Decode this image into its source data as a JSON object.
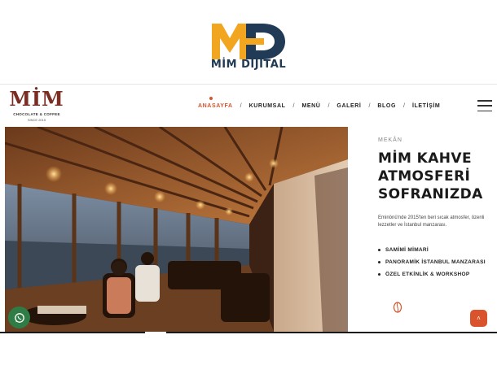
{
  "agency": {
    "name": "MİM DİJİTAL",
    "mark": "MD"
  },
  "brand": {
    "word": "MİM",
    "tagline": "CHOCOLATE & COFFEE",
    "since": "SINCE 2015"
  },
  "nav": {
    "items": [
      {
        "label": "ANASAYFA",
        "active": true
      },
      {
        "label": "KURUMSAL",
        "active": false
      },
      {
        "label": "MENÜ",
        "active": false
      },
      {
        "label": "GALERİ",
        "active": false
      },
      {
        "label": "BLOG",
        "active": false
      },
      {
        "label": "İLETİŞİM",
        "active": false
      }
    ],
    "separator": "/"
  },
  "hero": {
    "image": "restaurant-interior-wooden-ceiling-bosphorus-view"
  },
  "panel": {
    "eyebrow": "MEKÂN",
    "title": "MİM KAHVE ATMOSFERİ SOFRANIZDA",
    "description": "Eminönü'nde 2015'ten beri sıcak atmosfer, özenli lezzetler ve İstanbul manzarası.",
    "features": [
      "SAMİMİ MİMARİ",
      "PANORAMİK İSTANBUL MANZARASI",
      "ÖZEL ETKİNLİK & WORKSHOP"
    ],
    "icon": "coffee-bean-icon"
  },
  "colors": {
    "accent": "#d9532c",
    "brand": "#7a2d22",
    "agency_blue": "#213a55",
    "agency_orange": "#f2a51f",
    "whatsapp": "#2f7d46"
  },
  "floating": {
    "whatsapp_icon": "whatsapp-icon",
    "totop_icon": "chevron-up-icon",
    "totop_label": "˄"
  }
}
